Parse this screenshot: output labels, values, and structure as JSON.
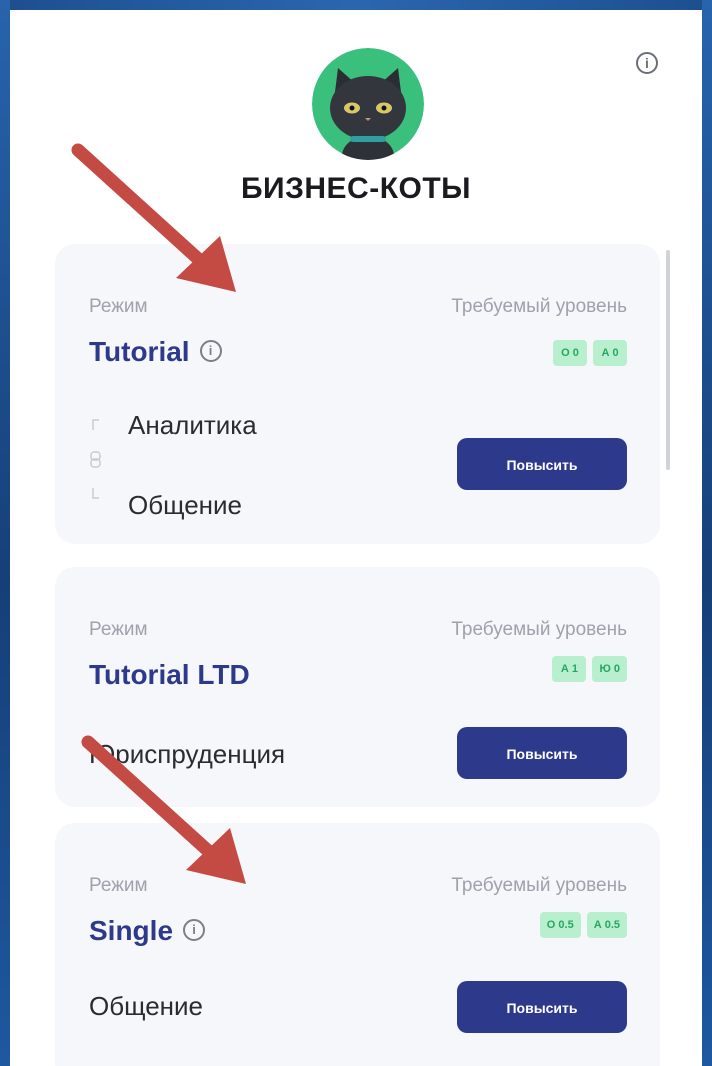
{
  "header": {
    "brand": "БИЗНЕС-КОТЫ"
  },
  "icons": {
    "info": "info-circle-icon",
    "avatar": "black-cat-avatar",
    "annotation": "red-arrow"
  },
  "colors": {
    "accent": "#2d3a8c",
    "badge_bg": "#b8f0cf",
    "badge_text": "#28a55f",
    "avatar_bg": "#3bbf7c",
    "annotation_arrow": "#c44a44"
  },
  "cards": [
    {
      "mode_label": "Режим",
      "mode_name": "Tutorial",
      "required_label": "Требуемый уровень",
      "badges": [
        "О 0",
        "А 0"
      ],
      "skills": [
        "Аналитика",
        "Общение"
      ],
      "button": "Повысить"
    },
    {
      "mode_label": "Режим",
      "mode_name": "Tutorial LTD",
      "required_label": "Требуемый уровень",
      "badges": [
        "А 1",
        "Ю 0"
      ],
      "skills": [
        "Юриспруденция"
      ],
      "button": "Повысить"
    },
    {
      "mode_label": "Режим",
      "mode_name": "Single",
      "required_label": "Требуемый уровень",
      "badges": [
        "О 0.5",
        "А 0.5"
      ],
      "skills": [
        "Общение"
      ],
      "button": "Повысить"
    }
  ]
}
